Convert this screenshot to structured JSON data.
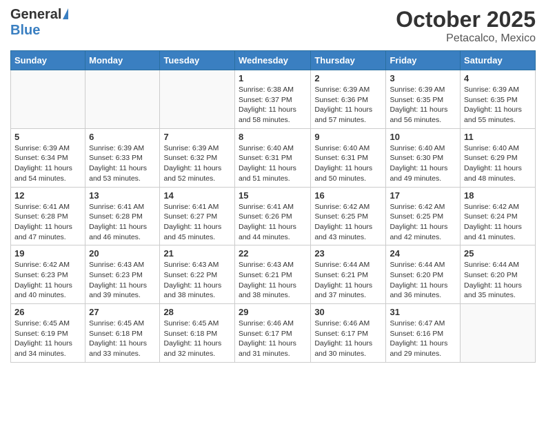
{
  "header": {
    "logo_general": "General",
    "logo_blue": "Blue",
    "month_title": "October 2025",
    "location": "Petacalco, Mexico"
  },
  "weekdays": [
    "Sunday",
    "Monday",
    "Tuesday",
    "Wednesday",
    "Thursday",
    "Friday",
    "Saturday"
  ],
  "weeks": [
    [
      {
        "day": "",
        "sunrise": "",
        "sunset": "",
        "daylight": ""
      },
      {
        "day": "",
        "sunrise": "",
        "sunset": "",
        "daylight": ""
      },
      {
        "day": "",
        "sunrise": "",
        "sunset": "",
        "daylight": ""
      },
      {
        "day": "1",
        "sunrise": "Sunrise: 6:38 AM",
        "sunset": "Sunset: 6:37 PM",
        "daylight": "Daylight: 11 hours and 58 minutes."
      },
      {
        "day": "2",
        "sunrise": "Sunrise: 6:39 AM",
        "sunset": "Sunset: 6:36 PM",
        "daylight": "Daylight: 11 hours and 57 minutes."
      },
      {
        "day": "3",
        "sunrise": "Sunrise: 6:39 AM",
        "sunset": "Sunset: 6:35 PM",
        "daylight": "Daylight: 11 hours and 56 minutes."
      },
      {
        "day": "4",
        "sunrise": "Sunrise: 6:39 AM",
        "sunset": "Sunset: 6:35 PM",
        "daylight": "Daylight: 11 hours and 55 minutes."
      }
    ],
    [
      {
        "day": "5",
        "sunrise": "Sunrise: 6:39 AM",
        "sunset": "Sunset: 6:34 PM",
        "daylight": "Daylight: 11 hours and 54 minutes."
      },
      {
        "day": "6",
        "sunrise": "Sunrise: 6:39 AM",
        "sunset": "Sunset: 6:33 PM",
        "daylight": "Daylight: 11 hours and 53 minutes."
      },
      {
        "day": "7",
        "sunrise": "Sunrise: 6:39 AM",
        "sunset": "Sunset: 6:32 PM",
        "daylight": "Daylight: 11 hours and 52 minutes."
      },
      {
        "day": "8",
        "sunrise": "Sunrise: 6:40 AM",
        "sunset": "Sunset: 6:31 PM",
        "daylight": "Daylight: 11 hours and 51 minutes."
      },
      {
        "day": "9",
        "sunrise": "Sunrise: 6:40 AM",
        "sunset": "Sunset: 6:31 PM",
        "daylight": "Daylight: 11 hours and 50 minutes."
      },
      {
        "day": "10",
        "sunrise": "Sunrise: 6:40 AM",
        "sunset": "Sunset: 6:30 PM",
        "daylight": "Daylight: 11 hours and 49 minutes."
      },
      {
        "day": "11",
        "sunrise": "Sunrise: 6:40 AM",
        "sunset": "Sunset: 6:29 PM",
        "daylight": "Daylight: 11 hours and 48 minutes."
      }
    ],
    [
      {
        "day": "12",
        "sunrise": "Sunrise: 6:41 AM",
        "sunset": "Sunset: 6:28 PM",
        "daylight": "Daylight: 11 hours and 47 minutes."
      },
      {
        "day": "13",
        "sunrise": "Sunrise: 6:41 AM",
        "sunset": "Sunset: 6:28 PM",
        "daylight": "Daylight: 11 hours and 46 minutes."
      },
      {
        "day": "14",
        "sunrise": "Sunrise: 6:41 AM",
        "sunset": "Sunset: 6:27 PM",
        "daylight": "Daylight: 11 hours and 45 minutes."
      },
      {
        "day": "15",
        "sunrise": "Sunrise: 6:41 AM",
        "sunset": "Sunset: 6:26 PM",
        "daylight": "Daylight: 11 hours and 44 minutes."
      },
      {
        "day": "16",
        "sunrise": "Sunrise: 6:42 AM",
        "sunset": "Sunset: 6:25 PM",
        "daylight": "Daylight: 11 hours and 43 minutes."
      },
      {
        "day": "17",
        "sunrise": "Sunrise: 6:42 AM",
        "sunset": "Sunset: 6:25 PM",
        "daylight": "Daylight: 11 hours and 42 minutes."
      },
      {
        "day": "18",
        "sunrise": "Sunrise: 6:42 AM",
        "sunset": "Sunset: 6:24 PM",
        "daylight": "Daylight: 11 hours and 41 minutes."
      }
    ],
    [
      {
        "day": "19",
        "sunrise": "Sunrise: 6:42 AM",
        "sunset": "Sunset: 6:23 PM",
        "daylight": "Daylight: 11 hours and 40 minutes."
      },
      {
        "day": "20",
        "sunrise": "Sunrise: 6:43 AM",
        "sunset": "Sunset: 6:23 PM",
        "daylight": "Daylight: 11 hours and 39 minutes."
      },
      {
        "day": "21",
        "sunrise": "Sunrise: 6:43 AM",
        "sunset": "Sunset: 6:22 PM",
        "daylight": "Daylight: 11 hours and 38 minutes."
      },
      {
        "day": "22",
        "sunrise": "Sunrise: 6:43 AM",
        "sunset": "Sunset: 6:21 PM",
        "daylight": "Daylight: 11 hours and 38 minutes."
      },
      {
        "day": "23",
        "sunrise": "Sunrise: 6:44 AM",
        "sunset": "Sunset: 6:21 PM",
        "daylight": "Daylight: 11 hours and 37 minutes."
      },
      {
        "day": "24",
        "sunrise": "Sunrise: 6:44 AM",
        "sunset": "Sunset: 6:20 PM",
        "daylight": "Daylight: 11 hours and 36 minutes."
      },
      {
        "day": "25",
        "sunrise": "Sunrise: 6:44 AM",
        "sunset": "Sunset: 6:20 PM",
        "daylight": "Daylight: 11 hours and 35 minutes."
      }
    ],
    [
      {
        "day": "26",
        "sunrise": "Sunrise: 6:45 AM",
        "sunset": "Sunset: 6:19 PM",
        "daylight": "Daylight: 11 hours and 34 minutes."
      },
      {
        "day": "27",
        "sunrise": "Sunrise: 6:45 AM",
        "sunset": "Sunset: 6:18 PM",
        "daylight": "Daylight: 11 hours and 33 minutes."
      },
      {
        "day": "28",
        "sunrise": "Sunrise: 6:45 AM",
        "sunset": "Sunset: 6:18 PM",
        "daylight": "Daylight: 11 hours and 32 minutes."
      },
      {
        "day": "29",
        "sunrise": "Sunrise: 6:46 AM",
        "sunset": "Sunset: 6:17 PM",
        "daylight": "Daylight: 11 hours and 31 minutes."
      },
      {
        "day": "30",
        "sunrise": "Sunrise: 6:46 AM",
        "sunset": "Sunset: 6:17 PM",
        "daylight": "Daylight: 11 hours and 30 minutes."
      },
      {
        "day": "31",
        "sunrise": "Sunrise: 6:47 AM",
        "sunset": "Sunset: 6:16 PM",
        "daylight": "Daylight: 11 hours and 29 minutes."
      },
      {
        "day": "",
        "sunrise": "",
        "sunset": "",
        "daylight": ""
      }
    ]
  ]
}
